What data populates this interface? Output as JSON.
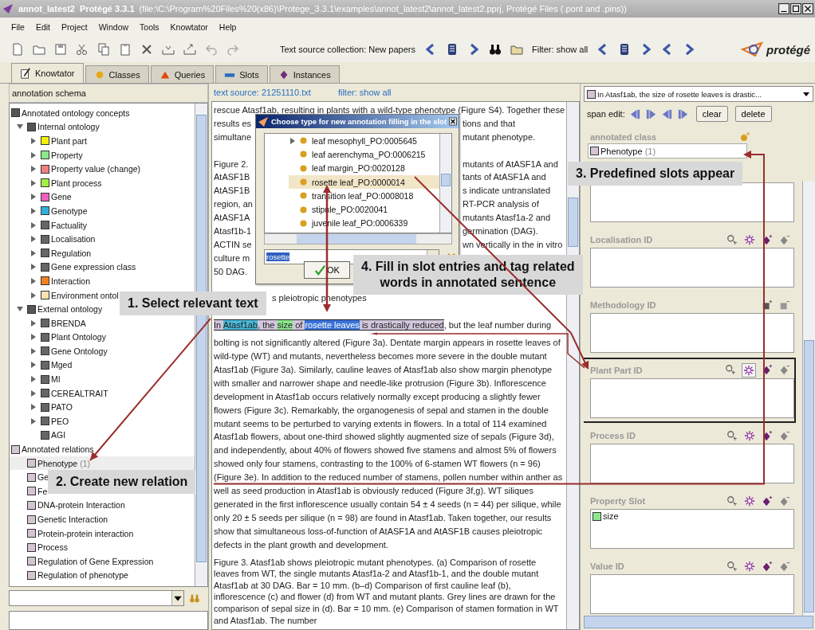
{
  "window": {
    "title": "annot_latest2  Protégé 3.3.1",
    "path": "(file:\\C:\\Program%20Files%20(x86)\\Protege_3.3.1\\examples\\annot_latest2\\annot_latest2.pprj, Protégé Files (.pont and .pins))"
  },
  "menu": [
    "File",
    "Edit",
    "Project",
    "Window",
    "Tools",
    "Knowtator",
    "Help"
  ],
  "toolbar": {
    "collection": "Text source collection: New papers",
    "filter": "Filter: show all",
    "logo": "protégé"
  },
  "tabs": [
    {
      "label": "Knowtator",
      "kind": "knowtator",
      "selected": true
    },
    {
      "label": "Classes",
      "kind": "classes",
      "selected": false
    },
    {
      "label": "Queries",
      "kind": "queries",
      "selected": false
    },
    {
      "label": "Slots",
      "kind": "slots",
      "selected": false
    },
    {
      "label": "Instances",
      "kind": "instances",
      "selected": false
    }
  ],
  "schema": {
    "title": "annotation schema",
    "tree": [
      {
        "label": "Annotated ontology concepts",
        "color": "#555555",
        "selected": false,
        "children": [
          {
            "label": "Internal ontology",
            "color": "#555555",
            "expanded": true,
            "selected": false,
            "children": [
              {
                "label": "Plant part",
                "color": "#f0f000",
                "expanded": false,
                "selected": false
              },
              {
                "label": "Property",
                "color": "#8ce88c",
                "expanded": false,
                "selected": false
              },
              {
                "label": "Property value (change)",
                "color": "#f08080",
                "expanded": false,
                "selected": false
              },
              {
                "label": "Plant process",
                "color": "#a0f040",
                "expanded": false,
                "selected": false
              },
              {
                "label": "Gene",
                "color": "#f060c0",
                "expanded": false,
                "selected": false
              },
              {
                "label": "Genotype",
                "color": "#30b0d8",
                "expanded": false,
                "selected": false
              },
              {
                "label": "Factuality",
                "color": "#666666",
                "expanded": false,
                "selected": false
              },
              {
                "label": "Localisation",
                "color": "#666666",
                "expanded": false,
                "selected": false
              },
              {
                "label": "Regulation",
                "color": "#666666",
                "expanded": false,
                "selected": false
              },
              {
                "label": "Gene expression class",
                "color": "#666666",
                "expanded": false,
                "selected": false
              },
              {
                "label": "Interaction",
                "color": "#f08020",
                "expanded": false,
                "selected": false
              },
              {
                "label": "Environment ontol",
                "color": "#fde0b0",
                "expanded": false,
                "selected": false
              }
            ]
          },
          {
            "label": "External ontology",
            "color": "#555555",
            "expanded": true,
            "selected": false,
            "children": [
              {
                "label": "BRENDA",
                "color": "#666666",
                "expanded": false,
                "selected": false
              },
              {
                "label": "Plant Ontology",
                "color": "#666666",
                "expanded": false,
                "selected": false
              },
              {
                "label": "Gene Ontology",
                "color": "#666666",
                "expanded": false,
                "selected": false
              },
              {
                "label": "Mged",
                "color": "#666666",
                "expanded": false,
                "selected": false
              },
              {
                "label": "MI",
                "color": "#666666",
                "expanded": false,
                "selected": false
              },
              {
                "label": "CEREALTRAIT",
                "color": "#666666",
                "expanded": false,
                "selected": false
              },
              {
                "label": "PATO",
                "color": "#666666",
                "expanded": false,
                "selected": false
              },
              {
                "label": "PEO",
                "color": "#666666",
                "expanded": false,
                "selected": false
              },
              {
                "label": "AGI",
                "color": "#666666",
                "selected": false
              }
            ]
          }
        ]
      },
      {
        "label": "Annotated relations",
        "color": "#d4c4d4",
        "selected": false,
        "children": [
          {
            "label": "Phenotype",
            "count": "(1)",
            "color": "#d4c4d4",
            "selected": true
          },
          {
            "label": "Ge",
            "color": "#d4c4d4",
            "selected": false
          },
          {
            "label": "Fe",
            "color": "#d4c4d4",
            "selected": false
          },
          {
            "label": "DNA-protein Interaction",
            "color": "#d4c4d4",
            "selected": false
          },
          {
            "label": "Genetic Interaction",
            "color": "#d4c4d4",
            "selected": false
          },
          {
            "label": "Protein-protein interaction",
            "color": "#d4c4d4",
            "selected": false
          },
          {
            "label": "Process",
            "color": "#d4c4d4",
            "selected": false
          },
          {
            "label": "Regulation of Gene Expression",
            "color": "#d4c4d4",
            "selected": false
          },
          {
            "label": "Regulation of phenotype",
            "color": "#d4c4d4",
            "selected": false
          }
        ]
      }
    ]
  },
  "document": {
    "source": "text source: 21251110.txt",
    "filter": "filter: show all",
    "lines": [
      {
        "kind": "full",
        "left": "rescue Atasf1ab, resulting in plants with a wild-type phenotype (Figure S4). Together these"
      },
      {
        "kind": "split",
        "left": "results es",
        "right": "tions and that"
      },
      {
        "kind": "split",
        "left": "simultane",
        "right": "mutant phenotype."
      },
      {
        "kind": "blank"
      },
      {
        "kind": "split",
        "left": "Figure 2.",
        "right": "mutants of AtASF1A and"
      },
      {
        "kind": "split",
        "left": "AtASF1B",
        "right": "tants of AtASF1A and"
      },
      {
        "kind": "split",
        "left": "AtASF1B",
        "right": "s indicate untranslated"
      },
      {
        "kind": "split",
        "left": "region, an",
        "right": "RT-PCR analysis of"
      },
      {
        "kind": "split",
        "left": "AtASF1A",
        "right": "mutants Atasf1a-2 and"
      },
      {
        "kind": "split",
        "left": "Atasf1b-1",
        "right": "germination (DAG)."
      },
      {
        "kind": "split",
        "left": "ACTIN se",
        "right": "wn vertically in the in vitro"
      },
      {
        "kind": "split",
        "left": "culture m"
      },
      {
        "kind": "split",
        "left": "50 DAG."
      },
      {
        "kind": "blank"
      },
      {
        "kind": "shifted",
        "left": "s pleiotropic phenotypes"
      },
      {
        "kind": "blank"
      }
    ],
    "segments": [
      {
        "text": "In ",
        "color": "#d2c6dc"
      },
      {
        "text": "Atasf1ab",
        "color": "#48b8d8"
      },
      {
        "text": ", the ",
        "color": "#d2c6dc"
      },
      {
        "text": "size",
        "color": "#8ce88c"
      },
      {
        "text": " of ",
        "color": "#d2c6dc"
      },
      {
        "text": "rosette leaves",
        "color": "#3a72d8"
      },
      {
        "text": " is drastically reduced",
        "color": "#d2c6dc"
      },
      {
        "text": ", but the leaf number during"
      }
    ],
    "paragraph": "bolting is not significantly altered (Figure 3a). Dentate margin appears in rosette leaves of wild-type (WT) and mutants, nevertheless becomes more severe in the double mutant Atasf1ab (Figure 3a). Similarly, cauline leaves of Atasf1ab also show margin phenotype with smaller and narrower shape and needle-like protrusion (Figure 3b). Inflorescence development in Atasf1ab occurs relatively normally except producing a slightly fewer flowers (Figure 3c). Remarkably, the organogenesis of sepal and stamen in the double mutant seems to be perturbed to varying extents in flowers. In a total of 114 examined Atasf1ab flowers, about one-third showed slightly augmented size of sepals (Figure 3d), and independently, about 40% of flowers showed five stamens and almost 5% of flowers showed only four stamens, contrasting to the 100% of 6-stamen WT flowers (n = 96) (Figure 3e). In addition to the reduced number of stamens, pollen number within anther as well as seed production in Atasf1ab is obviously reduced (Figure 3f,g). WT siliques generated in the first inflorescence usually contain 54 ± 4 seeds (n = 44) per silique, while only 20 ± 5 seeds per silique (n = 98) are found in Atasf1ab. Taken together, our results show that simultaneous loss-of-function of AtASF1A and AtASF1B causes pleiotropic defects in the plant growth and development.",
    "caption": "Figure 3.   Atasf1ab shows pleiotropic mutant phenotypes. (a) Comparison of rosette leaves from WT, the single mutants Atasf1a-2 and Atasf1b-1, and the double mutant Atasf1ab at 30 DAG. Bar = 10 mm. (b–d) Comparison of first cauline leaf (b), inflorescence (c) and flower (d) from WT and mutant plants. Grey lines are drawn for the comparison of sepal size in (d). Bar = 10 mm. (e) Comparison of stamen formation in WT and Atasf1ab. The number"
  },
  "dialog": {
    "title": "Choose type for new annotation filling in the slot",
    "items": [
      {
        "label": "leaf mesophyll_PO:0005645",
        "expanded": false,
        "selected": false
      },
      {
        "label": "leaf aerenchyma_PO:0006215",
        "selected": false
      },
      {
        "label": "leaf margin_PO:0020128",
        "selected": false
      },
      {
        "label": "rosette leaf_PO:0000014",
        "selected": true
      },
      {
        "label": "transition leaf_PO:0008018",
        "selected": false
      },
      {
        "label": "stipule_PO:0020041",
        "selected": false
      },
      {
        "label": "juvenile leaf_PO:0006339",
        "selected": false
      }
    ],
    "search": "rosette",
    "ok": "OK"
  },
  "annotation": {
    "selector": "In Atasf1ab, the size of rosette leaves is drastic...",
    "span_edit": "span edit:",
    "buttons": [
      "clear",
      "delete"
    ],
    "annotated_class": {
      "label": "annotated class",
      "value": "Phenotype",
      "count": "(1)",
      "color": "#d4c4d4"
    },
    "slots": [
      {
        "selected": false
      },
      {
        "label": "Localisation ID",
        "kind": "instance",
        "selected": false
      },
      {
        "label": "Methodology ID",
        "kind": "class",
        "selected": false
      },
      {
        "label": "Plant Part ID",
        "kind": "instance",
        "selected": true
      },
      {
        "label": "Process ID",
        "kind": "instance",
        "selected": false
      },
      {
        "label": "Property Slot",
        "kind": "instance",
        "selected": false,
        "values": [
          {
            "label": "size",
            "color": "#8ce88c"
          }
        ]
      },
      {
        "label": "Value ID",
        "kind": "instance",
        "selected": false
      }
    ]
  },
  "callouts": [
    {
      "text": "1. Select relevant text"
    },
    {
      "text": "2. Create new relation"
    },
    {
      "text": "3. Predefined slots appear"
    },
    {
      "text": "4. Fill in slot entries and tag related\nwords in annotated sentence"
    }
  ]
}
